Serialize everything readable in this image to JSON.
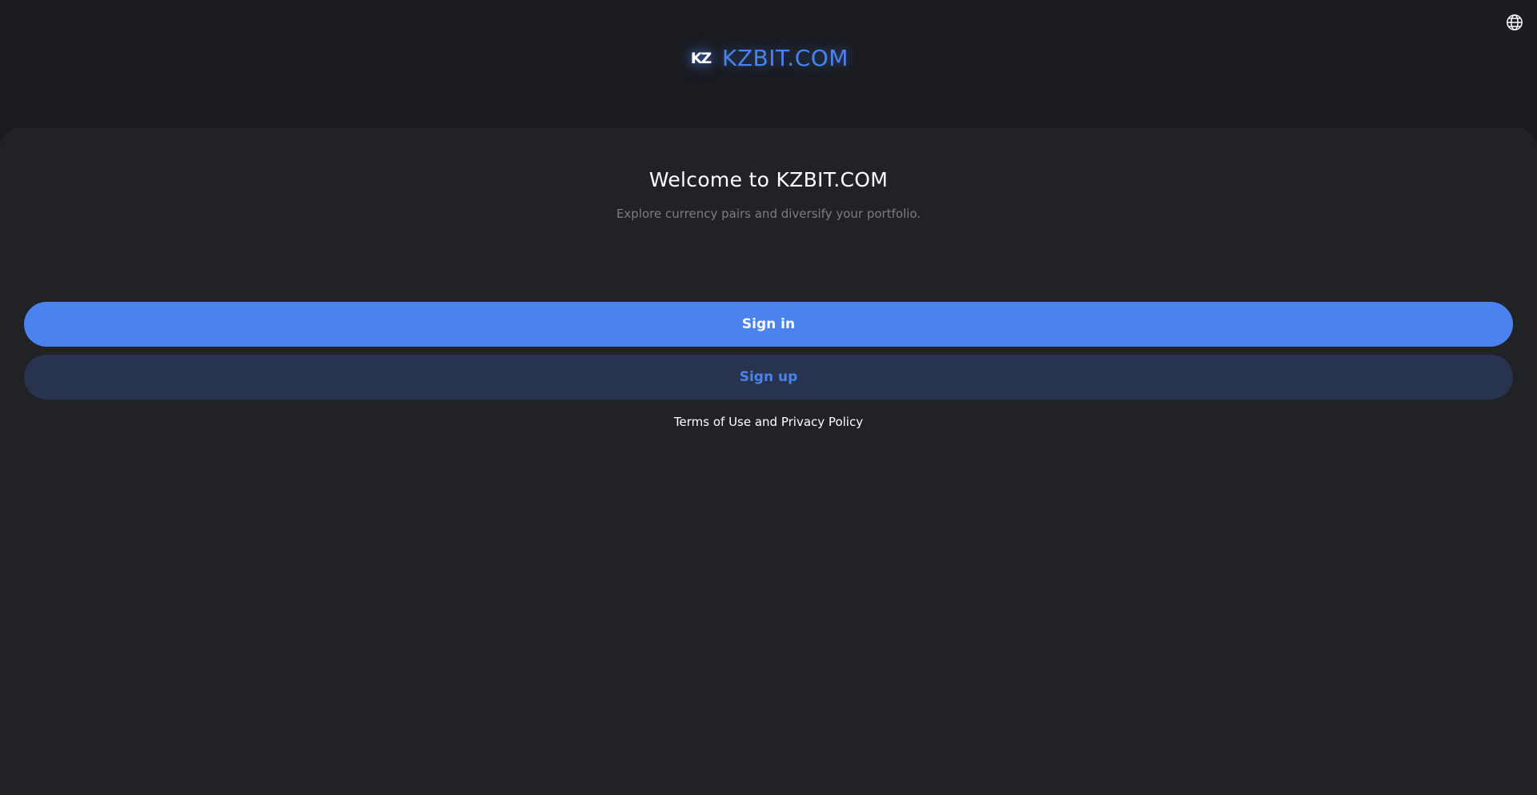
{
  "header": {
    "logo_mark": "KZ",
    "brand": "KZBIT.COM",
    "language_icon": "globe-icon"
  },
  "main": {
    "welcome": "Welcome to  KZBIT.COM",
    "subtitle": "Explore currency pairs and diversify your portfolio.",
    "sign_in_label": "Sign in",
    "sign_up_label": "Sign up",
    "terms_label": "Terms of Use and Privacy Policy"
  },
  "colors": {
    "accent": "#4a82ee",
    "background": "#1a1c20",
    "panel": "#202226",
    "secondary_button": "#283350"
  }
}
